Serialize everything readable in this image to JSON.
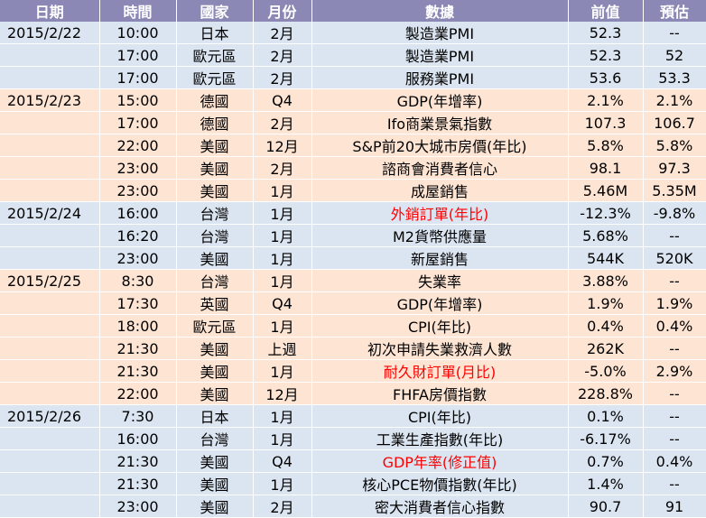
{
  "headers": [
    "日期",
    "時間",
    "國家",
    "月份",
    "數據",
    "前值",
    "預估"
  ],
  "colors": {
    "header_bg": "#8c88b5",
    "group_blue": "#dbe5f1",
    "group_peach": "#fde4d3",
    "highlight_text": "#ff0000"
  },
  "rows": [
    {
      "date": "2015/2/22",
      "time": "10:00",
      "country": "日本",
      "month": "2月",
      "data": "製造業PMI",
      "prev": "52.3",
      "forecast": "--",
      "group": "blue",
      "highlight": false
    },
    {
      "date": "",
      "time": "17:00",
      "country": "歐元區",
      "month": "2月",
      "data": "製造業PMI",
      "prev": "52.3",
      "forecast": "52",
      "group": "blue",
      "highlight": false
    },
    {
      "date": "",
      "time": "17:00",
      "country": "歐元區",
      "month": "2月",
      "data": "服務業PMI",
      "prev": "53.6",
      "forecast": "53.3",
      "group": "blue",
      "highlight": false
    },
    {
      "date": "2015/2/23",
      "time": "15:00",
      "country": "德國",
      "month": "Q4",
      "data": "GDP(年增率)",
      "prev": "2.1%",
      "forecast": "2.1%",
      "group": "peach",
      "highlight": false
    },
    {
      "date": "",
      "time": "17:00",
      "country": "德國",
      "month": "2月",
      "data": "Ifo商業景氣指數",
      "prev": "107.3",
      "forecast": "106.7",
      "group": "peach",
      "highlight": false
    },
    {
      "date": "",
      "time": "22:00",
      "country": "美國",
      "month": "12月",
      "data": "S&P前20大城市房價(年比)",
      "prev": "5.8%",
      "forecast": "5.8%",
      "group": "peach",
      "highlight": false
    },
    {
      "date": "",
      "time": "23:00",
      "country": "美國",
      "month": "2月",
      "data": "諮商會消費者信心",
      "prev": "98.1",
      "forecast": "97.3",
      "group": "peach",
      "highlight": false
    },
    {
      "date": "",
      "time": "23:00",
      "country": "美國",
      "month": "1月",
      "data": "成屋銷售",
      "prev": "5.46M",
      "forecast": "5.35M",
      "group": "peach",
      "highlight": false
    },
    {
      "date": "2015/2/24",
      "time": "16:00",
      "country": "台灣",
      "month": "1月",
      "data": "外銷訂單(年比)",
      "prev": "-12.3%",
      "forecast": "-9.8%",
      "group": "blue",
      "highlight": true
    },
    {
      "date": "",
      "time": "16:20",
      "country": "台灣",
      "month": "1月",
      "data": "M2貨幣供應量",
      "prev": "5.68%",
      "forecast": "--",
      "group": "blue",
      "highlight": false
    },
    {
      "date": "",
      "time": "23:00",
      "country": "美國",
      "month": "1月",
      "data": "新屋銷售",
      "prev": "544K",
      "forecast": "520K",
      "group": "blue",
      "highlight": false
    },
    {
      "date": "2015/2/25",
      "time": "8:30",
      "country": "台灣",
      "month": "1月",
      "data": "失業率",
      "prev": "3.88%",
      "forecast": "--",
      "group": "peach",
      "highlight": false
    },
    {
      "date": "",
      "time": "17:30",
      "country": "英國",
      "month": "Q4",
      "data": "GDP(年增率)",
      "prev": "1.9%",
      "forecast": "1.9%",
      "group": "peach",
      "highlight": false
    },
    {
      "date": "",
      "time": "18:00",
      "country": "歐元區",
      "month": "1月",
      "data": "CPI(年比)",
      "prev": "0.4%",
      "forecast": "0.4%",
      "group": "peach",
      "highlight": false
    },
    {
      "date": "",
      "time": "21:30",
      "country": "美國",
      "month": "上週",
      "data": "初次申請失業救濟人數",
      "prev": "262K",
      "forecast": "--",
      "group": "peach",
      "highlight": false
    },
    {
      "date": "",
      "time": "21:30",
      "country": "美國",
      "month": "1月",
      "data": "耐久財訂單(月比)",
      "prev": "-5.0%",
      "forecast": "2.9%",
      "group": "peach",
      "highlight": true
    },
    {
      "date": "",
      "time": "22:00",
      "country": "美國",
      "month": "12月",
      "data": "FHFA房價指數",
      "prev": "228.8%",
      "forecast": "--",
      "group": "peach",
      "highlight": false
    },
    {
      "date": "2015/2/26",
      "time": "7:30",
      "country": "日本",
      "month": "1月",
      "data": "CPI(年比)",
      "prev": "0.1%",
      "forecast": "--",
      "group": "blue",
      "highlight": false
    },
    {
      "date": "",
      "time": "16:00",
      "country": "台灣",
      "month": "1月",
      "data": "工業生產指數(年比)",
      "prev": "-6.17%",
      "forecast": "--",
      "group": "blue",
      "highlight": false
    },
    {
      "date": "",
      "time": "21:30",
      "country": "美國",
      "month": "Q4",
      "data": "GDP年率(修正值)",
      "prev": "0.7%",
      "forecast": "0.4%",
      "group": "blue",
      "highlight": true
    },
    {
      "date": "",
      "time": "21:30",
      "country": "美國",
      "month": "1月",
      "data": "核心PCE物價指數(年比)",
      "prev": "1.4%",
      "forecast": "--",
      "group": "blue",
      "highlight": false
    },
    {
      "date": "",
      "time": "23:00",
      "country": "美國",
      "month": "2月",
      "data": "密大消費者信心指數",
      "prev": "90.7",
      "forecast": "91",
      "group": "blue",
      "highlight": false
    }
  ]
}
